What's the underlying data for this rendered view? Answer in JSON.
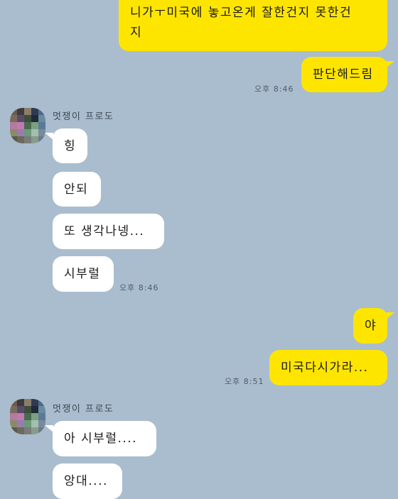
{
  "sender_name": "멋쟁이 프로도",
  "messages": {
    "me1_line1": "니가ㅜ미국에 놓고온게 잘한건지 못한건",
    "me1_line2": "지",
    "me2": "판단해드림",
    "time1": "오후 8:46",
    "other1": "힝",
    "other2": "안되",
    "other3": "또 생각나넹...",
    "other4": "시부럴",
    "time2": "오후 8:46",
    "me3": "야",
    "me4": "미국다시가라...",
    "time3": "오후 8:51",
    "other5": "아 시부럴....",
    "other6": "앙대...."
  },
  "avatar_colors": [
    "#6d5a4a",
    "#3e3a3d",
    "#8a7d6a",
    "#2f3a52",
    "#4d6a8a",
    "#7a6a5a",
    "#5a4a6a",
    "#3d4d3d",
    "#1e2a3a",
    "#6a8aa0",
    "#b47aa0",
    "#c07ab0",
    "#4a6a50",
    "#7aa080",
    "#5a7a9a",
    "#8a8a6a",
    "#9a7ab0",
    "#6a9a7a",
    "#a0c0b0",
    "#7a8a9a",
    "#5a5a4a",
    "#6a6a5a",
    "#7a7a7a",
    "#8a9a8a",
    "#6a7a8a"
  ],
  "colors": {
    "background": "#a9bdce",
    "my_bubble": "#fee500",
    "other_bubble": "#ffffff"
  }
}
